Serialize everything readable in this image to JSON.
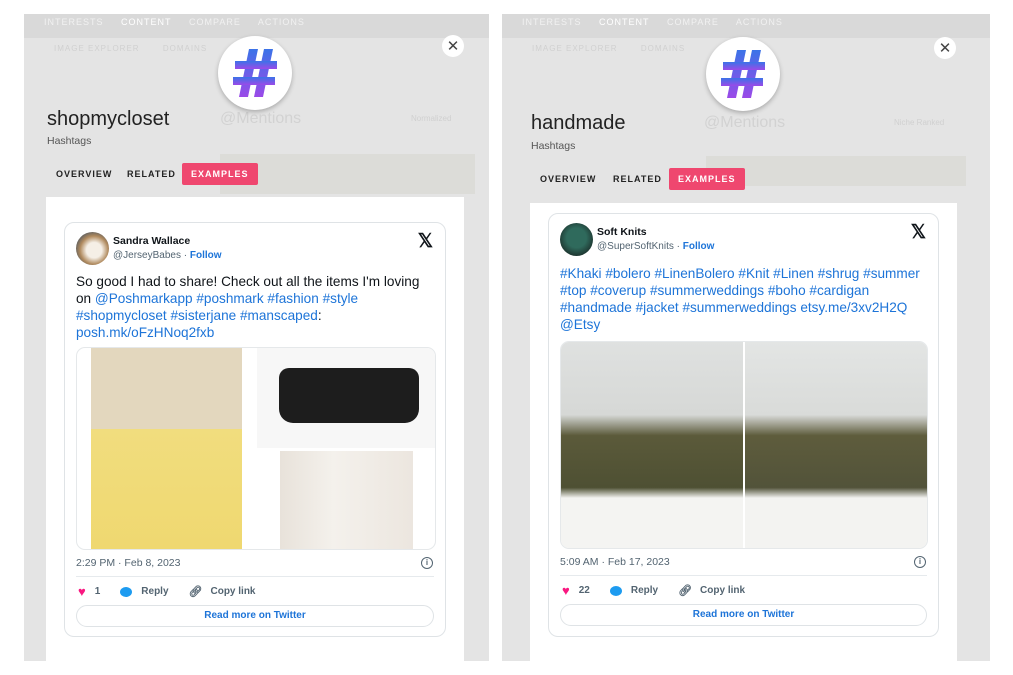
{
  "background": {
    "nav": [
      "INTERESTS",
      "CONTENT",
      "COMPARE",
      "ACTIONS"
    ],
    "subnav": [
      "IMAGE EXPLORER",
      "DOMAINS"
    ],
    "mentions_label": "@Mentions",
    "left_sort": "Normalized",
    "right_sort": "Niche Ranked"
  },
  "panels": [
    {
      "title": "shopmycloset",
      "subtitle": "Hashtags",
      "icon": "hashtag-icon",
      "tabs": [
        "OVERVIEW",
        "RELATED",
        "EXAMPLES"
      ],
      "active_tab": "EXAMPLES",
      "tweet": {
        "name": "Sandra Wallace",
        "handle": "@JerseyBabes",
        "follow": "Follow",
        "segments": [
          {
            "t": "So good I had to share! Check out all the items I'm loving on ",
            "link": false
          },
          {
            "t": "@Poshmarkapp",
            "link": true
          },
          {
            "t": " ",
            "link": false
          },
          {
            "t": "#poshmark",
            "link": true
          },
          {
            "t": " ",
            "link": false
          },
          {
            "t": "#fashion",
            "link": true
          },
          {
            "t": " ",
            "link": false
          },
          {
            "t": "#style",
            "link": true
          },
          {
            "t": " ",
            "link": false
          },
          {
            "t": "#shopmycloset",
            "link": true
          },
          {
            "t": " ",
            "link": false
          },
          {
            "t": "#sisterjane",
            "link": true
          },
          {
            "t": " ",
            "link": false
          },
          {
            "t": "#manscaped",
            "link": true
          },
          {
            "t": ": ",
            "link": false
          },
          {
            "t": "posh.mk/oFzHNoq2fxb",
            "link": true
          }
        ],
        "timestamp": "2:29 PM · Feb 8, 2023",
        "likes": "1",
        "reply": "Reply",
        "copy_link": "Copy link",
        "read_more": "Read more on Twitter"
      }
    },
    {
      "title": "handmade",
      "subtitle": "Hashtags",
      "icon": "hashtag-icon",
      "tabs": [
        "OVERVIEW",
        "RELATED",
        "EXAMPLES"
      ],
      "active_tab": "EXAMPLES",
      "tweet": {
        "name": "Soft Knits",
        "handle": "@SuperSoftKnits",
        "follow": "Follow",
        "segments": [
          {
            "t": "#Khaki",
            "link": true
          },
          {
            "t": " ",
            "link": false
          },
          {
            "t": "#bolero",
            "link": true
          },
          {
            "t": " ",
            "link": false
          },
          {
            "t": "#LinenBolero",
            "link": true
          },
          {
            "t": " ",
            "link": false
          },
          {
            "t": "#Knit",
            "link": true
          },
          {
            "t": " ",
            "link": false
          },
          {
            "t": "#Linen",
            "link": true
          },
          {
            "t": " ",
            "link": false
          },
          {
            "t": "#shrug",
            "link": true
          },
          {
            "t": " ",
            "link": false
          },
          {
            "t": "#summer",
            "link": true
          },
          {
            "t": " ",
            "link": false
          },
          {
            "t": "#top",
            "link": true
          },
          {
            "t": " ",
            "link": false
          },
          {
            "t": "#coverup",
            "link": true
          },
          {
            "t": " ",
            "link": false
          },
          {
            "t": "#summerweddings",
            "link": true
          },
          {
            "t": " ",
            "link": false
          },
          {
            "t": "#boho",
            "link": true
          },
          {
            "t": " ",
            "link": false
          },
          {
            "t": "#cardigan",
            "link": true
          },
          {
            "t": " ",
            "link": false
          },
          {
            "t": "#handmade",
            "link": true
          },
          {
            "t": " ",
            "link": false
          },
          {
            "t": "#jacket",
            "link": true
          },
          {
            "t": " ",
            "link": false
          },
          {
            "t": "#summerweddings",
            "link": true
          },
          {
            "t": " ",
            "link": false
          },
          {
            "t": "etsy.me/3xv2H2Q",
            "link": true
          },
          {
            "t": " ",
            "link": false
          },
          {
            "t": "@Etsy",
            "link": true
          }
        ],
        "timestamp": "5:09 AM · Feb 17, 2023",
        "likes": "22",
        "reply": "Reply",
        "copy_link": "Copy link",
        "read_more": "Read more on Twitter"
      }
    }
  ],
  "colors": {
    "accent": "#ef476f",
    "link": "#1d74d8",
    "like": "#f91880",
    "reply": "#1d9bf0"
  }
}
